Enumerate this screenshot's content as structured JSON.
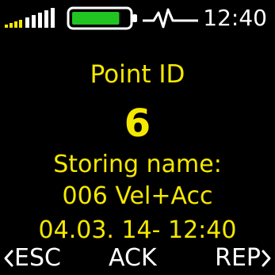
{
  "status_bar": {
    "signal_icon": "signal-strength-icon",
    "battery_icon": "battery-icon",
    "battery_level_fraction": 0.85,
    "battery_color": "#22c422",
    "pulse_icon": "heartbeat-pulse-icon",
    "time": "12:40"
  },
  "main": {
    "point_label": "Point ID",
    "point_value": "6",
    "storing_label": "Storing name:",
    "storing_name": "006 Vel+Acc",
    "storing_date": "04.03. 14- 12:40"
  },
  "softkeys": {
    "esc_label": "ESC",
    "ack_label": "ACK",
    "rep_label": "REP",
    "esc_icon": "chevron-left-icon",
    "rep_icon": "chevron-right-icon"
  },
  "colors": {
    "text_primary": "#f5e800",
    "text_secondary": "#ffffff",
    "background": "#000000",
    "signal": "#f5e800"
  }
}
